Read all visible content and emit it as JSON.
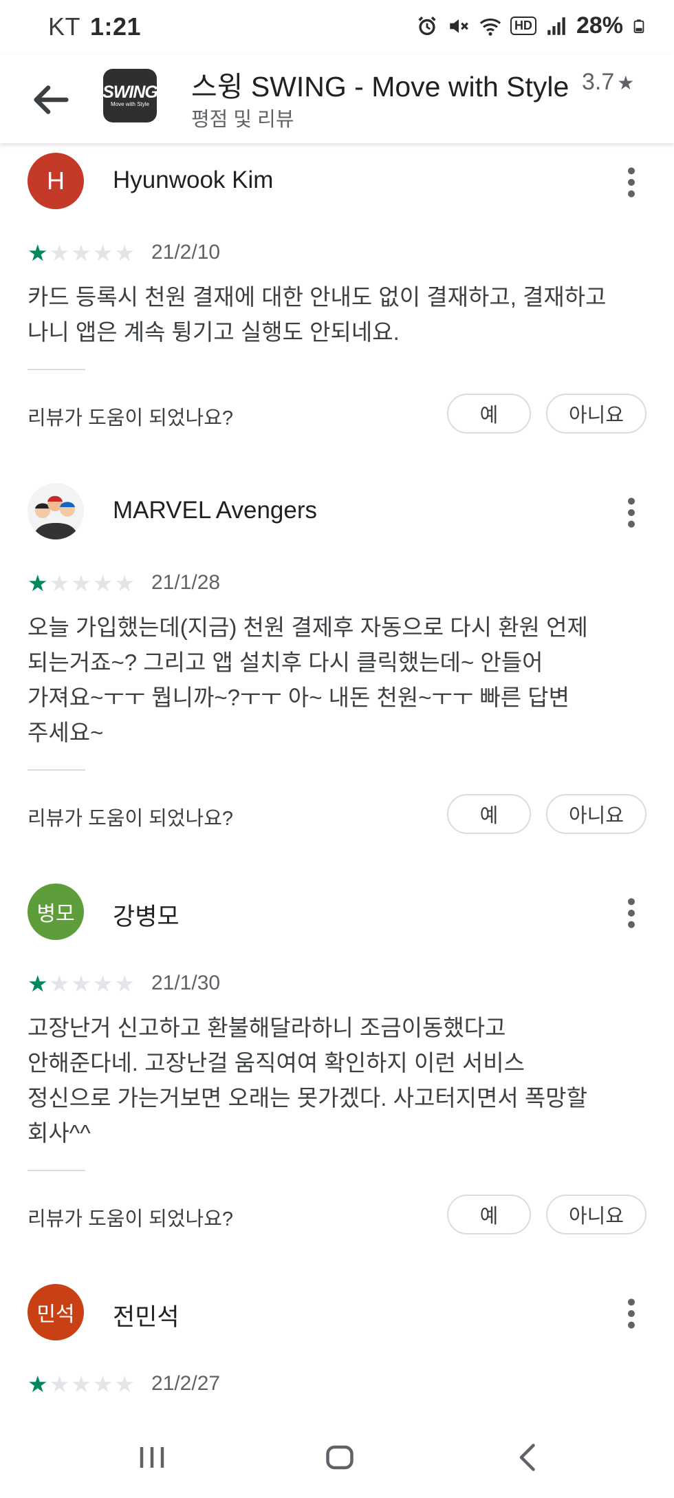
{
  "status_bar": {
    "carrier": "KT",
    "time": "1:21",
    "hd_label": "HD",
    "battery_percent": "28%",
    "icons": [
      "alarm-icon",
      "mute-icon",
      "wifi-icon",
      "hd-icon",
      "signal-icon",
      "battery-icon"
    ]
  },
  "header": {
    "app_icon_line1": "SWING",
    "app_icon_line2": "Move with Style",
    "title": "스윙 SWING - Move with Style",
    "rating": "3.7",
    "rating_star": "★",
    "subtitle": "평점 및 리뷰"
  },
  "reviews": [
    {
      "author": "Hyunwook Kim",
      "avatar_text": "H",
      "avatar_color": "#c53929",
      "rating": 1,
      "date": "21/2/10",
      "text_lines": [
        "카드 등록시 천원 결재에 대한 안내도 없이 결재하고, 결재하고",
        "나니 앱은 계속 튕기고 실행도 안되네요."
      ],
      "helpful_question": "리뷰가 도움이 되었나요?",
      "yes_label": "예",
      "no_label": "아니요"
    },
    {
      "author": "MARVEL Avengers",
      "avatar_text": "",
      "avatar_color": "#f1f3f4",
      "rating": 1,
      "date": "21/1/28",
      "text_lines": [
        "오늘 가입했는데(지금) 천원 결제후 자동으로 다시 환원 언제",
        "되는거죠~? 그리고 앱 설치후 다시 클릭했는데~ 안들어",
        "가져요~ㅜㅜ 뭡니까~?ㅜㅜ 아~ 내돈 천원~ㅜㅜ 빠른 답변",
        "주세요~"
      ],
      "helpful_question": "리뷰가 도움이 되었나요?",
      "yes_label": "예",
      "no_label": "아니요"
    },
    {
      "author": "강병모",
      "avatar_text": "병모",
      "avatar_color": "#5d9e3a",
      "rating": 1,
      "date": "21/1/30",
      "text_lines": [
        "고장난거 신고하고 환불해달라하니 조금이동했다고",
        "안해준다네. 고장난걸 움직여여 확인하지 이런 서비스",
        "정신으로 가는거보면 오래는 못가겠다. 사고터지면서 폭망할",
        "회사^^"
      ],
      "helpful_question": "리뷰가 도움이 되었나요?",
      "yes_label": "예",
      "no_label": "아니요"
    },
    {
      "author": "전민석",
      "avatar_text": "민석",
      "avatar_color": "#c84014",
      "rating": 1,
      "date": "21/2/27",
      "text_lines": [],
      "helpful_question": "",
      "yes_label": "",
      "no_label": ""
    }
  ],
  "colors": {
    "star_filled": "#01875f",
    "star_empty": "#e3e5e8",
    "text_primary": "#202124",
    "text_secondary": "#5f6368"
  },
  "nav_bar": {
    "icons": [
      "recent-apps-icon",
      "home-icon",
      "back-nav-icon"
    ]
  }
}
